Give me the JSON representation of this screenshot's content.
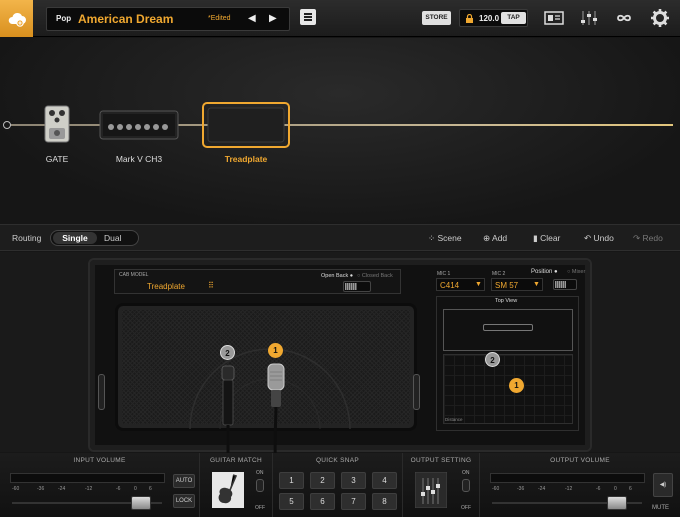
{
  "topbar": {
    "preset_category": "Pop",
    "preset_name": "American Dream",
    "preset_edited": "*Edited",
    "prev_icon": "prev-arrow-icon",
    "next_icon": "next-arrow-icon",
    "store_label": "STORE",
    "tempo_value": "120.0",
    "tap_label": "TAP",
    "icons": [
      "cloud-logo-icon",
      "menu-icon",
      "lock-icon",
      "tuner-icon",
      "mixer-icon",
      "loop-icon",
      "gear-icon"
    ]
  },
  "chain": {
    "modules": [
      {
        "label": "GATE"
      },
      {
        "label": "Mark V CH3"
      },
      {
        "label": "Treadplate",
        "selected": true
      }
    ]
  },
  "routing": {
    "label": "Routing",
    "options": [
      "Single",
      "Dual"
    ],
    "selected": "Single",
    "actions": [
      "Scene",
      "Add",
      "Clear",
      "Undo",
      "Redo"
    ]
  },
  "cab": {
    "model_label": "CAB MODEL",
    "model_name": "Treadplate",
    "open_back": "Open Back",
    "closed_back": "Closed Back",
    "mic1_label": "MIC 1",
    "mic1_value": "C414",
    "mic2_label": "MIC 2",
    "mic2_value": "SM 57",
    "position_label": "Position",
    "mixer_label": "Mixer",
    "top_view_label": "Top View",
    "distance_label": "Distance",
    "mic_numbers": [
      "2",
      "1"
    ]
  },
  "bottom": {
    "input_volume": {
      "title": "INPUT VOLUME",
      "scale": [
        "-60",
        "-36",
        "-24",
        "-12",
        "-6",
        "0",
        "6"
      ],
      "auto": "AUTO",
      "lock": "LOCK",
      "level": 0.85
    },
    "guitar_match": {
      "title": "GUITAR MATCH",
      "on": "ON",
      "off": "OFF"
    },
    "quick_snap": {
      "title": "QUICK SNAP",
      "buttons": [
        "1",
        "2",
        "3",
        "4",
        "5",
        "6",
        "7",
        "8"
      ]
    },
    "output_setting": {
      "title": "OUTPUT SETTING",
      "on": "ON",
      "off": "OFF"
    },
    "output_volume": {
      "title": "OUTPUT VOLUME",
      "scale": [
        "-60",
        "-36",
        "-24",
        "-12",
        "-6",
        "0",
        "6"
      ],
      "mute": "MUTE",
      "level": 0.82
    }
  },
  "colors": {
    "accent": "#f0a830",
    "background": "#161616",
    "panel": "#1d1d1d"
  }
}
